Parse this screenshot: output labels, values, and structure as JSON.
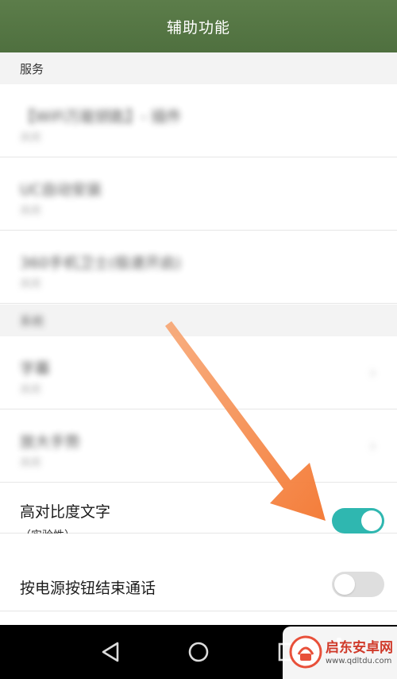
{
  "header": {
    "title": "辅助功能"
  },
  "sections": {
    "services_label": "服务",
    "system_label": "系统"
  },
  "services": [
    {
      "title": "【WiFi万能钥匙】- 插件",
      "sub": "关闭"
    },
    {
      "title": "UC自动安装",
      "sub": "关闭"
    },
    {
      "title": "360手机卫士(极速开启)",
      "sub": "关闭"
    }
  ],
  "system": [
    {
      "title": "字幕",
      "sub": "关闭"
    },
    {
      "title": "放大手势",
      "sub": "关闭"
    }
  ],
  "toggles": {
    "high_contrast": {
      "title": "高对比度文字",
      "sub": "（实验性）",
      "state": "on"
    },
    "power_end_call": {
      "title": "按电源按钮结束通话",
      "state": "off"
    }
  },
  "watermark": {
    "name": "启东安卓网",
    "url": "www.qdltdu.com"
  },
  "colors": {
    "header": "#547545",
    "toggle_on": "#2fb7b0",
    "toggle_off": "#dedede",
    "arrow": "#f58a4c"
  }
}
